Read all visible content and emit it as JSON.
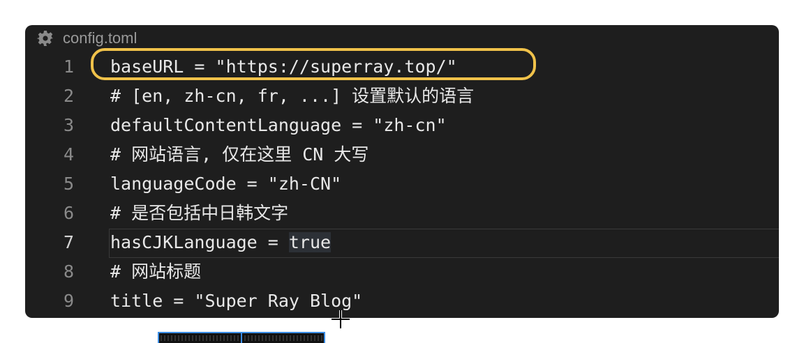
{
  "editor": {
    "filename": "config.toml",
    "icon": "gear-icon",
    "active_line": 7,
    "lines": [
      {
        "number": "1",
        "text": "baseURL = \"https://superray.top/\""
      },
      {
        "number": "2",
        "text": "# [en, zh-cn, fr, ...] 设置默认的语言"
      },
      {
        "number": "3",
        "text": "defaultContentLanguage = \"zh-cn\""
      },
      {
        "number": "4",
        "text": "# 网站语言, 仅在这里 CN 大写"
      },
      {
        "number": "5",
        "text": "languageCode = \"zh-CN\""
      },
      {
        "number": "6",
        "text": "# 是否包括中日韩文字"
      },
      {
        "number": "7",
        "text_before": "hasCJKLanguage = ",
        "text_highlight": "true"
      },
      {
        "number": "8",
        "text": "# 网站标题"
      },
      {
        "number": "9",
        "text": "title = \"Super Ray Blog\""
      }
    ]
  },
  "colors": {
    "editor_background": "#1e1e1e",
    "highlight_ring": "#f0c24a",
    "selection_border": "#3b8ee6"
  }
}
